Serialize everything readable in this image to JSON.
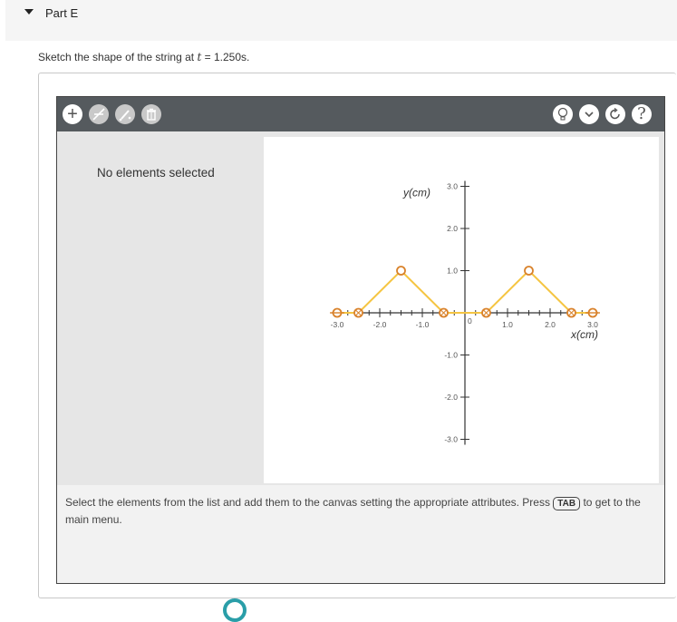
{
  "part": {
    "title": "Part E"
  },
  "prompt": {
    "before": "Sketch the shape of the string at ",
    "var": "t",
    "after": " = 1.250s."
  },
  "toolbar": {
    "left_buttons": [
      {
        "name": "add-element-button",
        "icon": "plus-icon",
        "glyph": "+",
        "disabled": false
      },
      {
        "name": "remove-line-button",
        "icon": "slash-line-icon",
        "glyph": "⟋",
        "disabled": true
      },
      {
        "name": "edit-points-button",
        "icon": "edit-points-icon",
        "glyph": "✎",
        "disabled": true
      },
      {
        "name": "delete-button",
        "icon": "trash-icon",
        "glyph": "🗑",
        "disabled": true
      }
    ],
    "right_buttons": [
      {
        "name": "hint-button",
        "icon": "lightbulb-icon",
        "glyph": "💡"
      },
      {
        "name": "menu-dropdown-button",
        "icon": "chevron-down-icon",
        "glyph": "⌄"
      },
      {
        "name": "reset-button",
        "icon": "reset-icon",
        "glyph": "↻"
      },
      {
        "name": "help-button",
        "icon": "help-icon",
        "glyph": "?"
      }
    ]
  },
  "sidebar": {
    "status": "No elements selected"
  },
  "chart_data": {
    "type": "line",
    "xlabel": "x(cm)",
    "ylabel": "y(cm)",
    "xlim": [
      -3.0,
      3.0
    ],
    "ylim": [
      -3.0,
      3.0
    ],
    "x_ticks": [
      "-3.0",
      "-2.0",
      "-1.0",
      "1.0",
      "2.0",
      "3.0"
    ],
    "y_ticks": [
      "3.0",
      "2.0",
      "1.0",
      "-1.0",
      "-2.0",
      "-3.0"
    ],
    "origin_label": "0",
    "series": [
      {
        "x": [
          -3.0,
          -2.5,
          -1.5,
          -0.5,
          0.5,
          1.5,
          2.5,
          3.0
        ],
        "y": [
          0.0,
          0.0,
          1.0,
          0.0,
          0.0,
          1.0,
          0.0,
          0.0
        ]
      }
    ],
    "colors": {
      "line": "#f5c542",
      "point": "#d9822b",
      "axis": "#333333"
    }
  },
  "instructions": {
    "before": "Select the elements from the list and add them to the canvas setting the appropriate attributes. Press ",
    "key": "TAB",
    "after": " to get to the main menu."
  }
}
